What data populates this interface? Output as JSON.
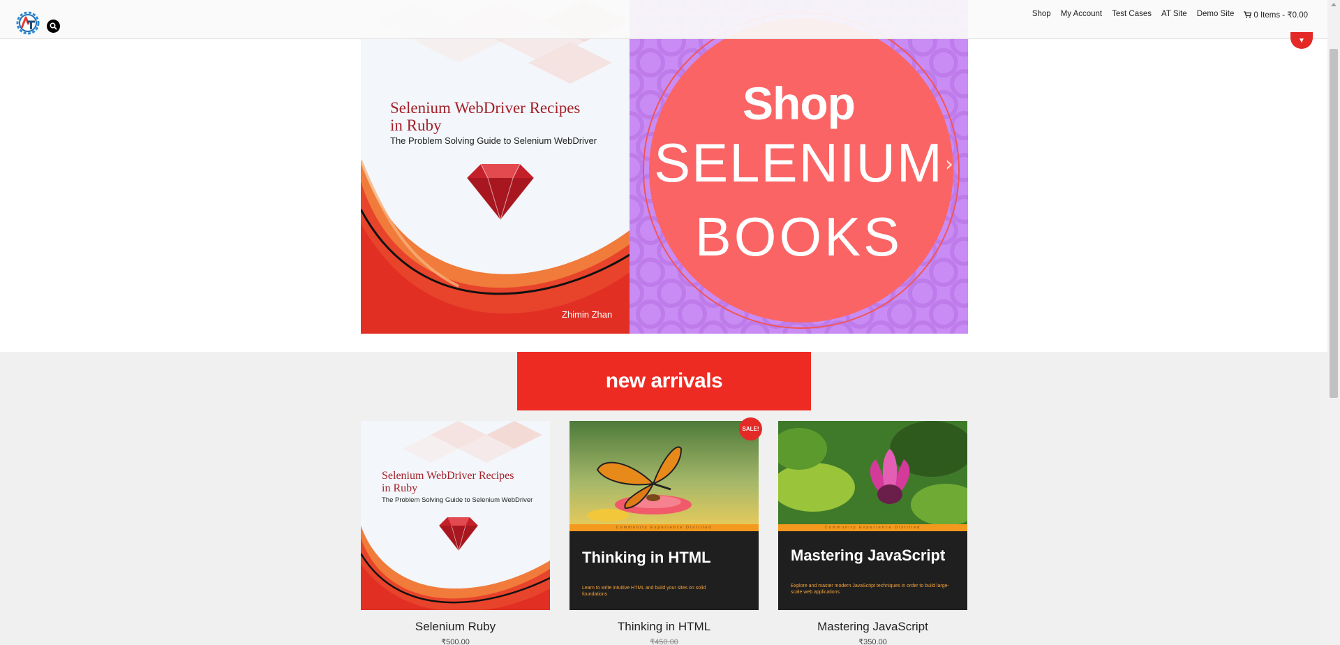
{
  "header": {
    "nav": [
      {
        "label": "Shop"
      },
      {
        "label": "My Account"
      },
      {
        "label": "Test Cases"
      },
      {
        "label": "AT Site"
      },
      {
        "label": "Demo Site"
      }
    ],
    "cart_label": "0 Items - ₹0.00"
  },
  "slider": {
    "book_title_line1": "Selenium WebDriver Recipes",
    "book_title_line2": "in Ruby",
    "book_subtitle": "The Problem Solving Guide to Selenium WebDriver",
    "book_author": "Zhimin Zhan",
    "shop_line1": "Shop",
    "shop_line2": "SELENIUM",
    "shop_line3": "BOOKS"
  },
  "banner": {
    "label": "new arrivals"
  },
  "products": [
    {
      "title": "Selenium Ruby",
      "price": "₹500.00",
      "cover_title_line1": "Selenium WebDriver Recipes",
      "cover_title_line2": "in Ruby",
      "cover_subtitle": "The Problem Solving Guide to Selenium WebDriver"
    },
    {
      "title": "Thinking in HTML",
      "price": "₹450.00",
      "sale_badge": "SALE!",
      "cover_tagline": "Community Experience Distilled",
      "cover_title": "Thinking in HTML",
      "cover_desc": "Learn to write intuitive HTML and build your sites on solid foundations"
    },
    {
      "title": "Mastering JavaScript",
      "price": "₹350.00",
      "cover_tagline": "Community Experience Distilled",
      "cover_title": "Mastering JavaScript",
      "cover_desc": "Explore and master modern JavaScript techniques in order to build large-scale web applications"
    }
  ],
  "colors": {
    "accent_red": "#ee2b23",
    "shop_panel": "#c98cf4",
    "shop_circle": "#fb6464"
  }
}
